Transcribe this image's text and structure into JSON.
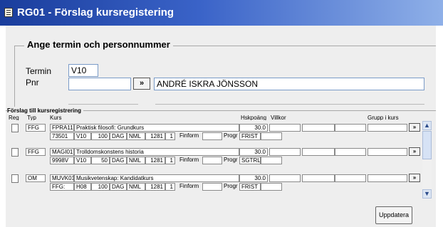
{
  "window": {
    "title": "RG01 - Förslag kursregistering"
  },
  "search": {
    "legend": "Ange termin och personnummer",
    "termin_label": "Termin",
    "termin_value": "V10",
    "pnr_label": "Pnr",
    "pnr_value": "",
    "lookup_button": "»",
    "name_value": "ANDRÉ ISKRA JÖNSSON"
  },
  "list": {
    "legend": "Förslag till kursregistrering",
    "headers": {
      "reg": "Reg",
      "typ": "Typ",
      "kurs": "Kurs",
      "hskpoang": "Hskpoäng",
      "villkor": "Villkor",
      "grupp": "Grupp i kurs"
    },
    "rows": [
      {
        "typ": "FFG",
        "code": "FPRA11",
        "name": "Praktisk filosofi: Grundkurs",
        "points": "30.0",
        "line2": {
          "id": "73501",
          "term": "V10",
          "pace": "100",
          "time": "DAG",
          "ort": "NML",
          "num": "1281",
          "one": "1",
          "form": "Finform",
          "progr": "Progr",
          "status": "FRIST"
        },
        "btn": "»"
      },
      {
        "typ": "FFG",
        "code": "MAGI01",
        "name": "Trolldomskonstens historia",
        "points": "30.0",
        "line2": {
          "id": "9998V",
          "term": "V10",
          "pace": "50",
          "time": "DAG",
          "ort": "NML",
          "num": "1281",
          "one": "1",
          "form": "Finform",
          "progr": "Progr",
          "status": "SGTRL"
        },
        "btn": "»"
      },
      {
        "typ": "OM",
        "code": "MUVK01",
        "name": "Musikvetenskap: Kandidatkurs",
        "points": "30.0",
        "line2": {
          "id": "FFG:",
          "term": "H08",
          "pace": "100",
          "time": "DAG",
          "ort": "NML",
          "num": "1281",
          "one": "1",
          "form": "Finform",
          "progr": "Progr",
          "status": "FRIST"
        },
        "btn": "»"
      }
    ]
  },
  "scrollbar": {
    "up_icon": "chevron-up-icon",
    "down_icon": "chevron-down-icon"
  },
  "actions": {
    "update_label": "Uppdatera"
  },
  "colors": {
    "titlebar_start": "#1a3d9c",
    "titlebar_end": "#8fb0e8",
    "panel": "#eeeeee"
  }
}
